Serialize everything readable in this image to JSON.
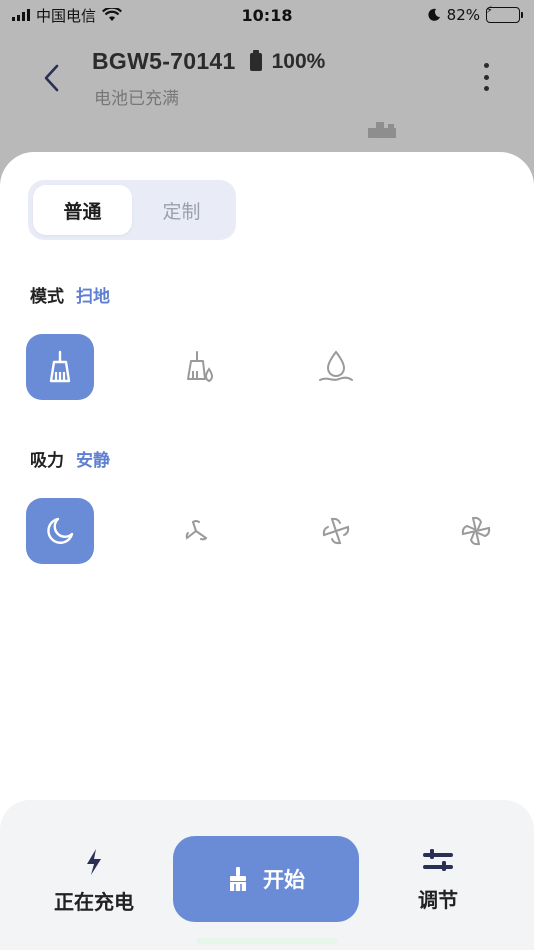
{
  "status_bar": {
    "carrier": "中国电信",
    "time": "10:18",
    "battery_percent": "82%",
    "battery_level": 0.82,
    "battery_color": "#3fc845"
  },
  "header": {
    "device_name": "BGW5-70141",
    "battery_percent": "100%",
    "subtitle": "电池已充满",
    "icons": [
      "back-icon",
      "battery-icon",
      "more-vertical-icon"
    ]
  },
  "tabs": [
    {
      "label": "普通",
      "active": true
    },
    {
      "label": "定制",
      "active": false
    }
  ],
  "mode": {
    "label": "模式",
    "value": "扫地",
    "options": [
      {
        "icon": "broom-icon",
        "selected": true
      },
      {
        "icon": "broom-mop-icon",
        "selected": false
      },
      {
        "icon": "mop-drop-icon",
        "selected": false
      }
    ]
  },
  "suction": {
    "label": "吸力",
    "value": "安静",
    "options": [
      {
        "icon": "moon-icon",
        "selected": true
      },
      {
        "icon": "fan-level-1-icon",
        "selected": false
      },
      {
        "icon": "fan-level-2-icon",
        "selected": false
      },
      {
        "icon": "fan-level-3-icon",
        "selected": false
      }
    ]
  },
  "bottom_bar": {
    "charging_label": "正在充电",
    "start_label": "开始",
    "adjust_label": "调节",
    "icons": [
      "lightning-icon",
      "broom-icon",
      "sliders-icon"
    ]
  },
  "colors": {
    "accent": "#6a8bd6",
    "accent_text": "#5f7fd1",
    "inactive_icon": "#9a9a9a"
  }
}
